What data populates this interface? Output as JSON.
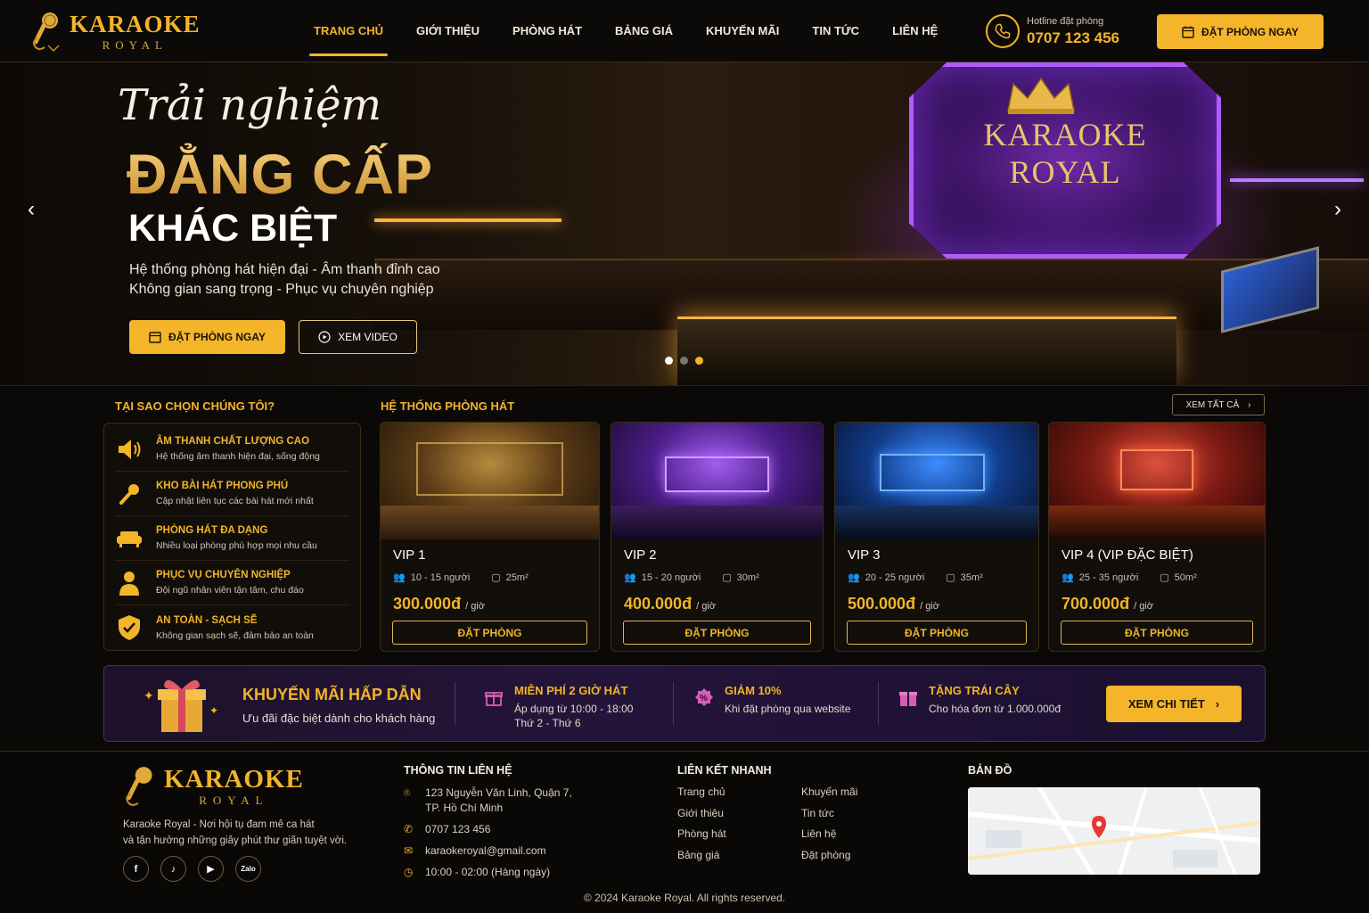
{
  "brand": {
    "name": "KARAOKE",
    "sub": "ROYAL"
  },
  "nav": [
    {
      "label": "TRANG CHỦ",
      "active": true
    },
    {
      "label": "GIỚI THIỆU"
    },
    {
      "label": "PHÒNG HÁT"
    },
    {
      "label": "BẢNG GIÁ"
    },
    {
      "label": "KHUYẾN MÃI"
    },
    {
      "label": "TIN TỨC"
    },
    {
      "label": "LIÊN HỆ"
    }
  ],
  "hotline": {
    "label": "Hotline đặt phòng",
    "number": "0707 123 456"
  },
  "header_cta": "ĐẶT PHÒNG NGAY",
  "hero": {
    "script": "Trải nghiệm",
    "title": "ĐẲNG CẤP",
    "subtitle": "KHÁC BIỆT",
    "line1": "Hệ thống phòng hát hiện đại - Âm thanh đỉnh cao",
    "line2": "Không gian sang trọng - Phục vụ chuyên nghiệp",
    "cta_primary": "ĐẶT PHÒNG NGAY",
    "cta_secondary": "XEM VIDEO",
    "screen_line1": "KARAOKE",
    "screen_line2": "ROYAL",
    "slide_count": 3,
    "active_slide": 1
  },
  "why": {
    "title": "TẠI SAO CHỌN CHÚNG TÔI?",
    "items": [
      {
        "icon": "speaker-icon",
        "title": "ÂM THANH CHẤT LƯỢNG CAO",
        "desc": "Hệ thống âm thanh hiện đại, sống động"
      },
      {
        "icon": "microphone-icon",
        "title": "KHO BÀI HÁT PHONG PHÚ",
        "desc": "Cập nhật liên tục các bài hát mới nhất"
      },
      {
        "icon": "sofa-icon",
        "title": "PHÒNG HÁT ĐA DẠNG",
        "desc": "Nhiều loại phòng phù hợp mọi nhu cầu"
      },
      {
        "icon": "staff-icon",
        "title": "PHỤC VỤ CHUYÊN NGHIỆP",
        "desc": "Đội ngũ nhân viên tận tâm, chu đáo"
      },
      {
        "icon": "shield-check-icon",
        "title": "AN TOÀN - SẠCH SẼ",
        "desc": "Không gian sạch sẽ, đảm bảo an toàn"
      }
    ]
  },
  "rooms": {
    "title": "HỆ THỐNG PHÒNG HÁT",
    "see_all": "XEM TẤT CẢ",
    "book_label": "ĐẶT PHÒNG",
    "per_hour": "/ giờ",
    "items": [
      {
        "name": "VIP 1",
        "people": "10 - 15 người",
        "area": "25m²",
        "price": "300.000đ",
        "theme": "gold"
      },
      {
        "name": "VIP 2",
        "people": "15 - 20 người",
        "area": "30m²",
        "price": "400.000đ",
        "theme": "purple"
      },
      {
        "name": "VIP 3",
        "people": "20 - 25 người",
        "area": "35m²",
        "price": "500.000đ",
        "theme": "blue"
      },
      {
        "name": "VIP 4 (VIP ĐẶC BIỆT)",
        "people": "25 - 35 người",
        "area": "50m²",
        "price": "700.000đ",
        "theme": "red"
      }
    ]
  },
  "promo": {
    "title": "KHUYẾN MÃI HẤP DẪN",
    "subtitle": "Ưu đãi đặc biệt dành cho khách hàng",
    "items": [
      {
        "icon": "gift-box-icon",
        "title": "MIỄN PHÍ 2 GIỜ HÁT",
        "line1": "Áp dụng từ 10:00 - 18:00",
        "line2": "Thứ 2 - Thứ 6"
      },
      {
        "icon": "discount-icon",
        "title": "GIẢM 10%",
        "line1": "Khi đặt phòng qua website",
        "line2": ""
      },
      {
        "icon": "gift-icon",
        "title": "TẶNG TRÁI CÂY",
        "line1": "Cho hóa đơn từ 1.000.000đ",
        "line2": ""
      }
    ],
    "cta": "XEM CHI TIẾT"
  },
  "footer": {
    "about1": "Karaoke Royal - Nơi hội tụ đam mê ca hát",
    "about2": "và tận hưởng những giây phút thư giãn tuyệt vời.",
    "contact_title": "THÔNG TIN LIÊN HỆ",
    "address1": "123 Nguyễn Văn Linh, Quận 7,",
    "address2": "TP. Hồ Chí Minh",
    "phone": "0707 123 456",
    "email": "karaokeroyal@gmail.com",
    "hours": "10:00 - 02:00 (Hàng ngày)",
    "links_title": "LIÊN KẾT NHANH",
    "links_col1": [
      "Trang chủ",
      "Giới thiệu",
      "Phòng hát",
      "Bảng giá"
    ],
    "links_col2": [
      "Khuyến mãi",
      "Tin tức",
      "Liên hệ",
      "Đặt phòng"
    ],
    "map_title": "BẢN ĐỒ",
    "socials": [
      "facebook-icon",
      "tiktok-icon",
      "youtube-icon",
      "zalo-icon"
    ],
    "copyright": "© 2024 Karaoke Royal. All rights reserved."
  },
  "colors": {
    "accent": "#f2b429",
    "bg": "#0b0907",
    "promo_bg": "#24143a"
  }
}
